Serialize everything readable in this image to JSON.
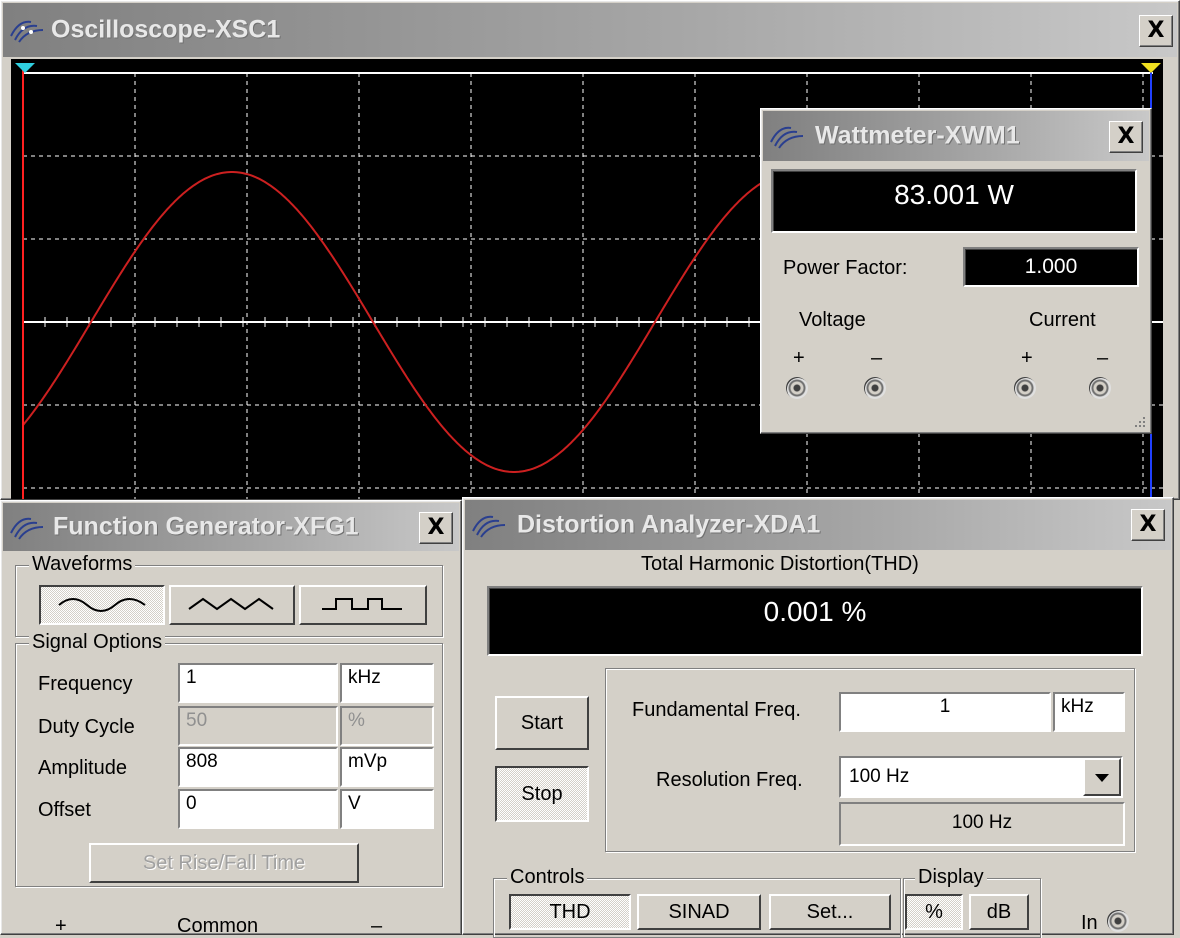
{
  "oscilloscope": {
    "title": "Oscilloscope-XSC1",
    "close_label": "X",
    "trace_color": "#cc2020",
    "grid_color": "#ffffff",
    "cursor1_color": "#ff2020",
    "cursor2_color": "#2040ff"
  },
  "wattmeter": {
    "title": "Wattmeter-XWM1",
    "close_label": "X",
    "reading": "83.001 W",
    "power_factor_label": "Power Factor:",
    "power_factor_value": "1.000",
    "voltage_label": "Voltage",
    "current_label": "Current",
    "plus": "+",
    "minus": "–"
  },
  "function_generator": {
    "title": "Function Generator-XFG1",
    "close_label": "X",
    "waveforms_label": "Waveforms",
    "waveforms": [
      "sine-wave-icon",
      "triangle-wave-icon",
      "square-wave-icon"
    ],
    "signal_options_label": "Signal Options",
    "rows": [
      {
        "label": "Frequency",
        "value": "1",
        "unit": "kHz",
        "enabled": true
      },
      {
        "label": "Duty Cycle",
        "value": "50",
        "unit": "%",
        "enabled": false
      },
      {
        "label": "Amplitude",
        "value": "808",
        "unit": "mVp",
        "enabled": true
      },
      {
        "label": "Offset",
        "value": "0",
        "unit": "V",
        "enabled": true
      }
    ],
    "rise_fall_label": "Set Rise/Fall Time",
    "plus": "+",
    "common": "Common",
    "minus": "–"
  },
  "distortion_analyzer": {
    "title": "Distortion Analyzer-XDA1",
    "close_label": "X",
    "thd_label": "Total Harmonic Distortion(THD)",
    "reading": "0.001 %",
    "start_label": "Start",
    "stop_label": "Stop",
    "fundamental_label": "Fundamental Freq.",
    "fundamental_value": "1",
    "fundamental_unit": "kHz",
    "resolution_label": "Resolution Freq.",
    "resolution_value": "100 Hz",
    "resolution_display": "100 Hz",
    "controls_label": "Controls",
    "controls": [
      "THD",
      "SINAD",
      "Set..."
    ],
    "display_label": "Display",
    "display_options": [
      "%",
      "dB"
    ],
    "in_label": "In"
  }
}
